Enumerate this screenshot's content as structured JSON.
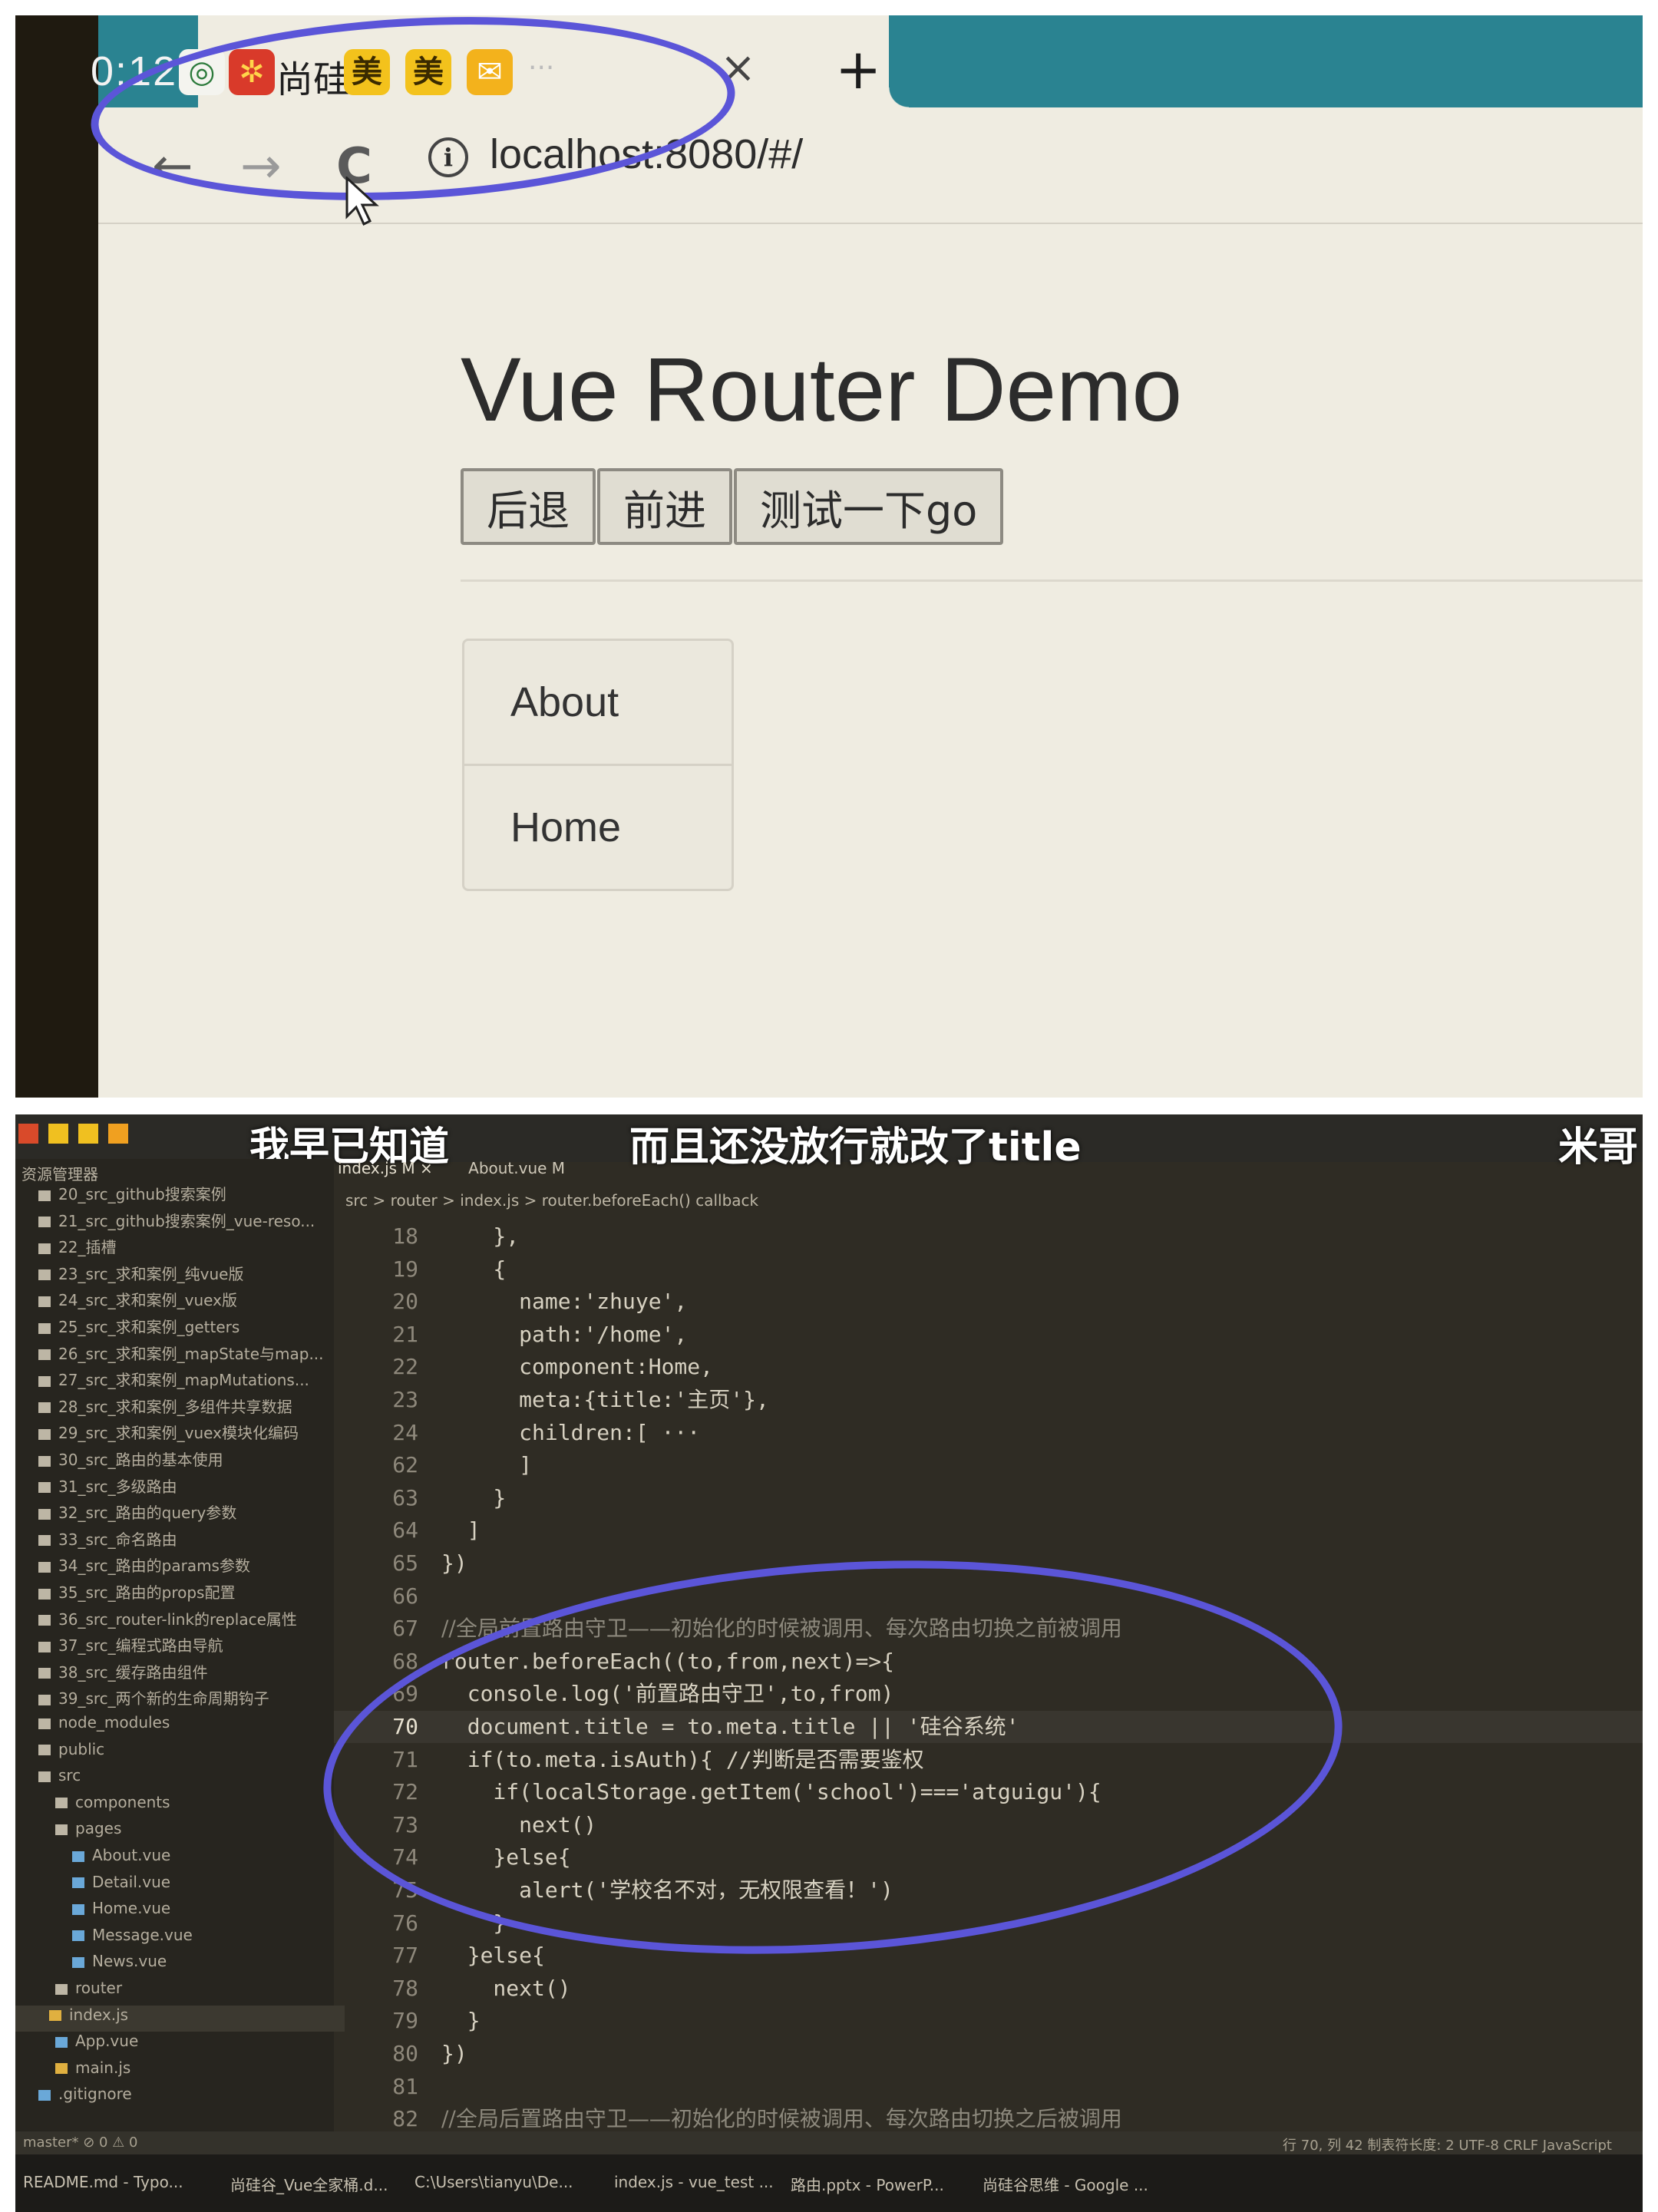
{
  "browser": {
    "tab_time": "0:12",
    "tab_partial_title": "尚硅",
    "tab_icons": [
      "美",
      "美"
    ],
    "tab_more": "···",
    "tab_close": "×",
    "new_tab": "+",
    "back": "←",
    "forward": "→",
    "reload": "C",
    "url": "localhost:8080/#/",
    "info_icon": "i"
  },
  "page": {
    "title": "Vue Router Demo",
    "buttons": [
      "后退",
      "前进",
      "测试一下go"
    ],
    "nav_items": [
      "About",
      "Home"
    ]
  },
  "overlay_text": {
    "sub1": "我早已知道",
    "sub2": "而且还没放行就改了title",
    "sub3": "米哥"
  },
  "vscode": {
    "tabs": [
      "index.js M ×",
      "About.vue M"
    ],
    "breadcrumb": "src > router > index.js > router.beforeEach() callback",
    "explorer_items": [
      "20_src_github搜索案例",
      "21_src_github搜索案例_vue-reso...",
      "22_插槽",
      "23_src_求和案例_纯vue版",
      "24_src_求和案例_vuex版",
      "25_src_求和案例_getters",
      "26_src_求和案例_mapState与map...",
      "27_src_求和案例_mapMutations...",
      "28_src_求和案例_多组件共享数据",
      "29_src_求和案例_vuex模块化编码",
      "30_src_路由的基本使用",
      "31_src_多级路由",
      "32_src_路由的query参数",
      "33_src_命名路由",
      "34_src_路由的params参数",
      "35_src_路由的props配置",
      "36_src_router-link的replace属性",
      "37_src_编程式路由导航",
      "38_src_缓存路由组件",
      "39_src_两个新的生命周期钩子",
      "node_modules",
      "public",
      "src",
      "components",
      "pages",
      "About.vue",
      "Detail.vue",
      "Home.vue",
      "Message.vue",
      "News.vue",
      "router",
      "index.js",
      "App.vue",
      "main.js",
      ".gitignore"
    ],
    "lines": [
      {
        "n": "18",
        "t": "    },"
      },
      {
        "n": "19",
        "t": "    {"
      },
      {
        "n": "20",
        "t": "      name:'zhuye',"
      },
      {
        "n": "21",
        "t": "      path:'/home',"
      },
      {
        "n": "22",
        "t": "      component:Home,"
      },
      {
        "n": "23",
        "t": "      meta:{title:'主页'},"
      },
      {
        "n": "24",
        "t": "      children:[ ···"
      },
      {
        "n": "62",
        "t": "      ]"
      },
      {
        "n": "63",
        "t": "    }"
      },
      {
        "n": "64",
        "t": "  ]"
      },
      {
        "n": "65",
        "t": "})"
      },
      {
        "n": "66",
        "t": ""
      },
      {
        "n": "67",
        "t": "//全局前置路由守卫——初始化的时候被调用、每次路由切换之前被调用"
      },
      {
        "n": "68",
        "t": "router.beforeEach((to,from,next)=>{"
      },
      {
        "n": "69",
        "t": "  console.log('前置路由守卫',to,from)"
      },
      {
        "n": "70",
        "t": "  document.title = to.meta.title || '硅谷系统'"
      },
      {
        "n": "71",
        "t": "  if(to.meta.isAuth){ //判断是否需要鉴权"
      },
      {
        "n": "72",
        "t": "    if(localStorage.getItem('school')==='atguigu'){"
      },
      {
        "n": "73",
        "t": "      next()"
      },
      {
        "n": "74",
        "t": "    }else{"
      },
      {
        "n": "75",
        "t": "      alert('学校名不对，无权限查看！')"
      },
      {
        "n": "76",
        "t": "    }"
      },
      {
        "n": "77",
        "t": "  }else{"
      },
      {
        "n": "78",
        "t": "    next()"
      },
      {
        "n": "79",
        "t": "  }"
      },
      {
        "n": "80",
        "t": "})"
      },
      {
        "n": "81",
        "t": ""
      },
      {
        "n": "82",
        "t": "//全局后置路由守卫——初始化的时候被调用、每次路由切换之后被调用"
      }
    ],
    "status_left": "master*  ⊘ 0 ⚠ 0",
    "status_right": "行 70, 列 42   制表符长度: 2   UTF-8   CRLF   JavaScript",
    "taskbar_items": [
      "README.md - Typo...",
      "尚硅谷_Vue全家桶.d...",
      "C:\\Users\\tianyu\\De...",
      "index.js - vue_test ...",
      "路由.pptx - PowerP...",
      "尚硅谷思维 - Google ..."
    ]
  },
  "colors": {
    "browser_bg": "#efece1",
    "tabstrip": "#2a8391",
    "annotation": "#5b55d8",
    "editor_bg": "#2f2c24"
  }
}
